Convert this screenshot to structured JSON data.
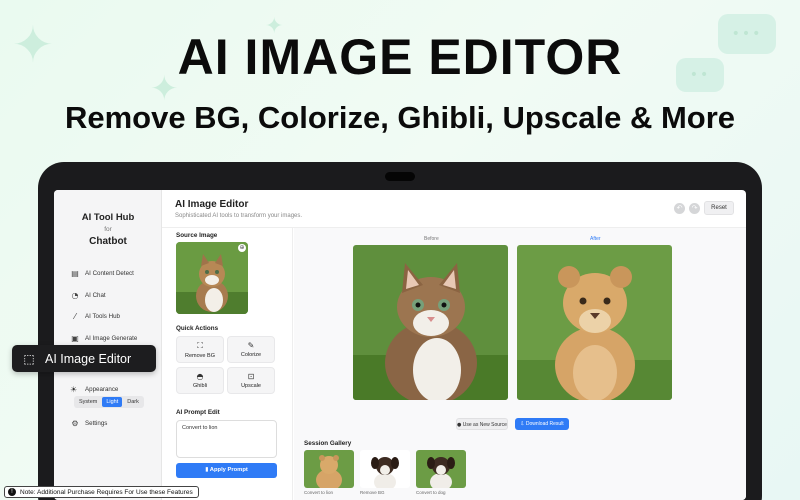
{
  "headline": "AI IMAGE EDITOR",
  "subheadline": "Remove BG, Colorize, Ghibli, Upscale & More",
  "sidebar": {
    "brand_line1": "AI Tool Hub",
    "brand_line2": "for",
    "brand_line3": "Chatbot",
    "items": [
      {
        "label": "AI Content Detect",
        "icon": "document-scan-icon"
      },
      {
        "label": "AI Chat",
        "icon": "chat-icon"
      },
      {
        "label": "AI Tools Hub",
        "icon": "magic-wand-icon"
      },
      {
        "label": "AI Image Generate",
        "icon": "image-icon"
      }
    ],
    "appearance_label": "Appearance",
    "appearance_options": [
      "System",
      "Light",
      "Dark"
    ],
    "appearance_selected": "Light",
    "settings_label": "Settings"
  },
  "highlight_label": "AI Image Editor",
  "header": {
    "title": "AI Image Editor",
    "subtitle": "Sophisticated AI tools to transform your images.",
    "reset_label": "Reset"
  },
  "left_panel": {
    "source_label": "Source Image",
    "quick_actions_label": "Quick Actions",
    "actions": [
      {
        "label": "Remove BG",
        "icon": "scan-icon"
      },
      {
        "label": "Colorize",
        "icon": "brush-icon"
      },
      {
        "label": "Ghibli",
        "icon": "palette-icon"
      },
      {
        "label": "Upscale",
        "icon": "upscale-icon"
      }
    ],
    "prompt_label": "AI Prompt Edit",
    "prompt_value": "Convert to lion",
    "apply_label": "Apply Prompt"
  },
  "main": {
    "before_label": "Before",
    "after_label": "After",
    "use_source_label": "Use as New Source",
    "download_label": "Download Result",
    "gallery_title": "Session Gallery",
    "gallery": [
      {
        "caption": "Convert to lion"
      },
      {
        "caption": "Remove BG"
      },
      {
        "caption": "Convert to dog"
      }
    ]
  },
  "note": "Note: Additional Purchase Requires For Use these Features",
  "colors": {
    "accent": "#2f7bf6",
    "dark": "#1d1d1f"
  }
}
